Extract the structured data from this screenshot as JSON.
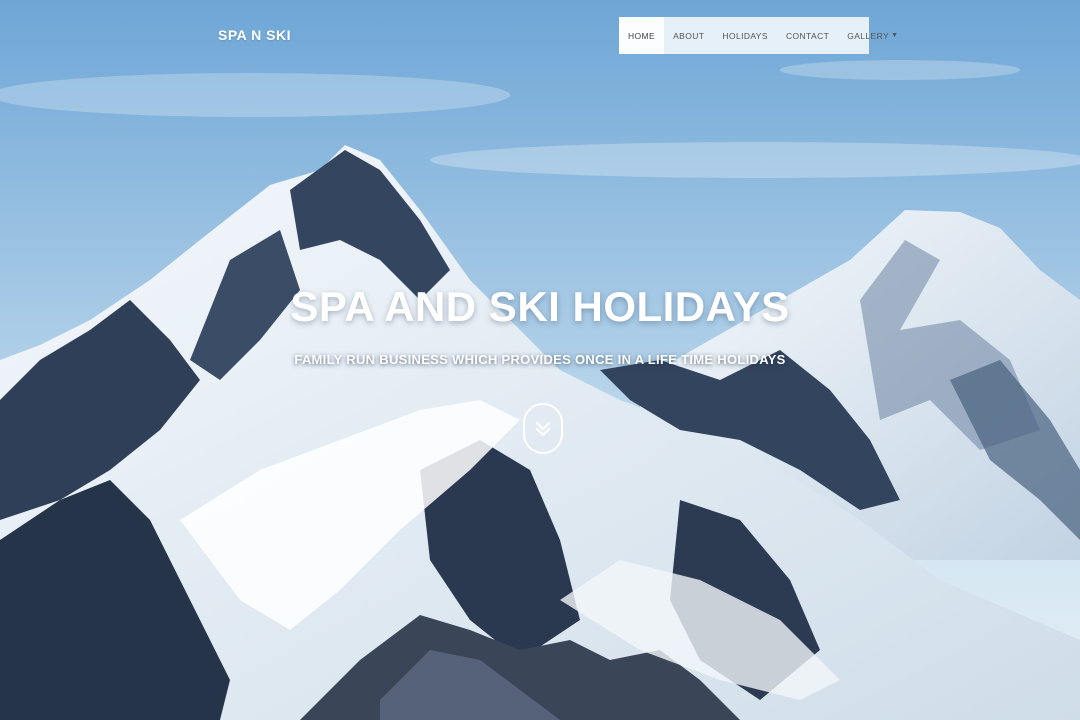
{
  "brand": {
    "name": "SPA N SKI"
  },
  "nav": {
    "items": [
      {
        "label": "HOME",
        "active": true
      },
      {
        "label": "ABOUT"
      },
      {
        "label": "HOLIDAYS"
      },
      {
        "label": "CONTACT"
      },
      {
        "label": "GALLERY",
        "dropdown": true
      }
    ]
  },
  "hero": {
    "title": "SPA AND SKI HOLIDAYS",
    "subtitle": "FAMILY RUN BUSINESS WHICH PROVIDES ONCE IN A LIFE TIME HOLIDAYS",
    "scroll_icon": "double-chevron-down-icon"
  },
  "colors": {
    "sky_top": "#6fa6d6",
    "sky_bottom": "#cfe3f1",
    "snow": "#eef4f9",
    "rock": "#2d3b52",
    "nav_bg": "#ffffff",
    "text": "#ffffff"
  }
}
